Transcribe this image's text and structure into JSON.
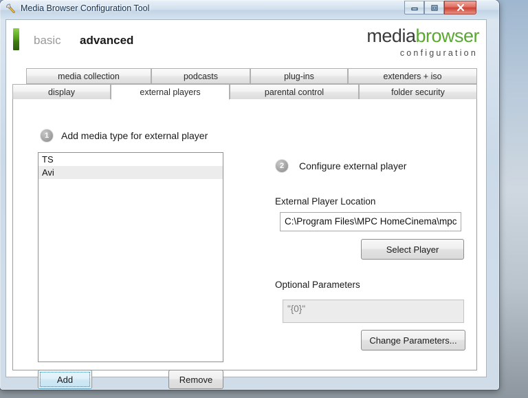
{
  "window": {
    "title": "Media Browser Configuration Tool",
    "icon": "wrench-icon",
    "controls": {
      "minimize": "minimize-icon",
      "maximize": "maximize-icon",
      "close": "close-icon"
    }
  },
  "header": {
    "mode_basic": "basic",
    "mode_advanced": "advanced",
    "logo_media": "media",
    "logo_browser": "browser",
    "logo_sub": "configuration",
    "accent_green": "#5aa832"
  },
  "tabs": {
    "top_row": [
      {
        "label": "media collection",
        "active": false
      },
      {
        "label": "podcasts",
        "active": false
      },
      {
        "label": "plug-ins",
        "active": false
      },
      {
        "label": "extenders + iso",
        "active": false
      }
    ],
    "bottom_row": [
      {
        "label": "display",
        "active": false
      },
      {
        "label": "external players",
        "active": true
      },
      {
        "label": "parental control",
        "active": false
      },
      {
        "label": "folder security",
        "active": false
      }
    ]
  },
  "panel": {
    "step1": {
      "number": "1",
      "label": "Add media type for external player",
      "list_items": [
        {
          "label": "TS",
          "selected": false
        },
        {
          "label": "Avi",
          "selected": true
        }
      ],
      "add_button": "Add",
      "remove_button": "Remove"
    },
    "step2": {
      "number": "2",
      "label": "Configure external player",
      "player_location_label": "External Player Location",
      "player_location_value": "C:\\Program Files\\MPC HomeCinema\\mpc",
      "select_player_button": "Select Player",
      "optional_parameters_label": "Optional Parameters",
      "optional_parameters_value": "\"{0}\"",
      "change_parameters_button": "Change Parameters..."
    }
  }
}
